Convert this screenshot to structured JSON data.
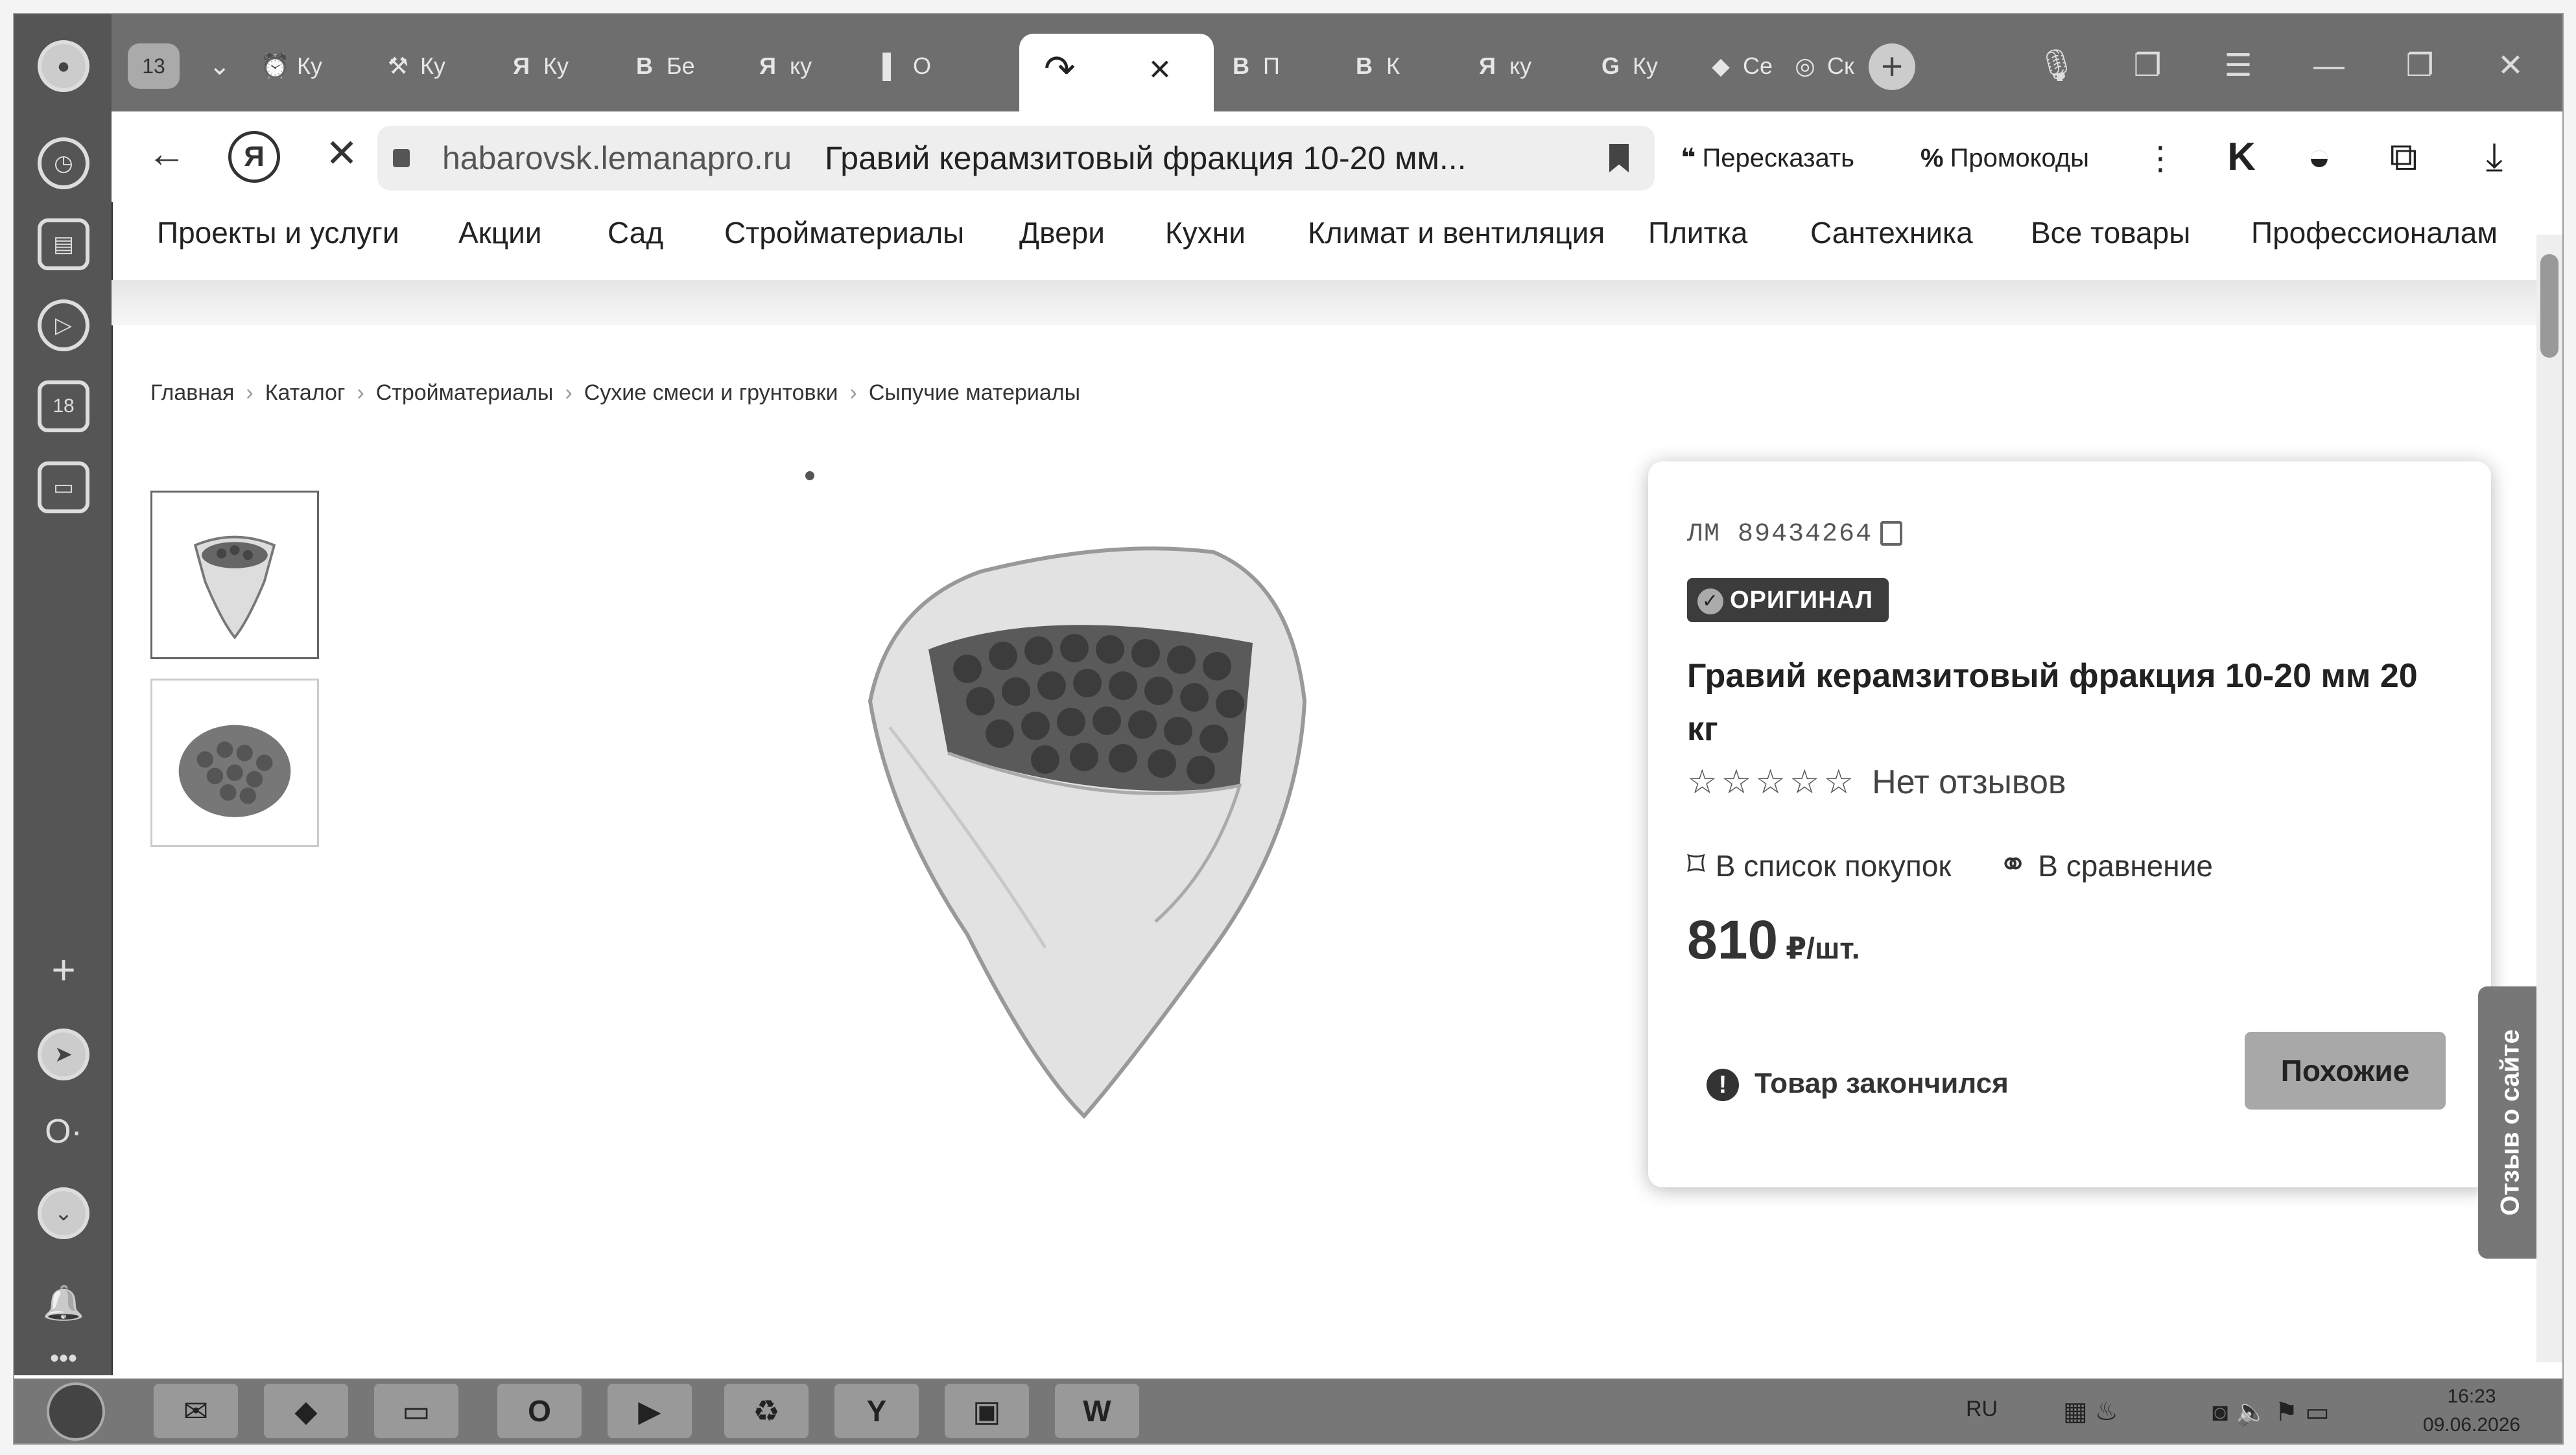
{
  "browser": {
    "tab_counter": "13",
    "tabs": [
      {
        "icon": "alarm-icon",
        "glyph": "⏰",
        "label": "Ку"
      },
      {
        "icon": "hammer-icon",
        "glyph": "⚒",
        "label": "Ку"
      },
      {
        "icon": "yandex-icon",
        "glyph": "Я",
        "label": "Ку"
      },
      {
        "icon": "vk-icon",
        "glyph": "В",
        "label": "Бе"
      },
      {
        "icon": "yandex-icon",
        "glyph": "Я",
        "label": "ку"
      },
      {
        "icon": "bookmark-icon",
        "glyph": "▌",
        "label": "О"
      },
      {
        "icon": "vk-icon",
        "glyph": "В",
        "label": "П"
      },
      {
        "icon": "vk-icon",
        "glyph": "В",
        "label": "К"
      },
      {
        "icon": "yandex-icon",
        "glyph": "Я",
        "label": "ку"
      },
      {
        "icon": "google-icon",
        "glyph": "G",
        "label": "Ку"
      },
      {
        "icon": "tab-icon",
        "glyph": "◆",
        "label": "Се"
      },
      {
        "icon": "chrome-icon",
        "glyph": "◎",
        "label": "Ск"
      }
    ],
    "url": "habarovsk.lemanapro.ru",
    "page_title": "Гравий керамзитовый фракция 10-20 мм...",
    "retell_label": "Пересказать",
    "promo_label": "Промокоды"
  },
  "site_nav": [
    "Проекты и услуги",
    "Акции",
    "Сад",
    "Стройматериалы",
    "Двери",
    "Кухни",
    "Климат и вентиляция",
    "Плитка",
    "Сантехника",
    "Все товары",
    "Профессионалам"
  ],
  "breadcrumb": [
    "Главная",
    "Каталог",
    "Стройматериалы",
    "Сухие смеси и грунтовки",
    "Сыпучие материалы"
  ],
  "product": {
    "sku": "ЛМ 89434264",
    "badge": "ОРИГИНАЛ",
    "title": "Гравий керамзитовый фракция 10-20 мм 20 кг",
    "stars": "☆☆☆☆☆",
    "reviews": "Нет отзывов",
    "rating": 0,
    "shopping_list": "В список покупок",
    "compare": "В сравнение",
    "price": "810",
    "price_unit": "₽/шт.",
    "stock_status": "Товар закончился",
    "similar_button": "Похожие"
  },
  "feedback_tab": "Отзыв о сайте",
  "taskbar": {
    "apps": [
      {
        "icon": "mail-app-icon",
        "glyph": "✉"
      },
      {
        "icon": "anydesk-icon",
        "glyph": "◆"
      },
      {
        "icon": "explorer-folder-icon",
        "glyph": "▭"
      },
      {
        "icon": "opera-icon",
        "glyph": "O"
      },
      {
        "icon": "media-player-icon",
        "glyph": "▶"
      },
      {
        "icon": "recycle-icon",
        "glyph": "♻"
      },
      {
        "icon": "yandex-browser-icon",
        "glyph": "Y"
      },
      {
        "icon": "window-icon",
        "glyph": "▣"
      },
      {
        "icon": "word-icon",
        "glyph": "W"
      }
    ],
    "language": "RU",
    "time": "16:23",
    "date": "09.06.2026"
  }
}
